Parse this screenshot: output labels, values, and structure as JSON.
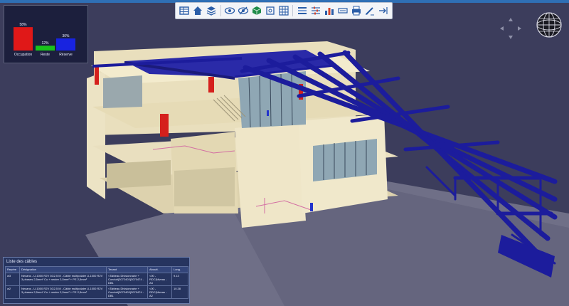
{
  "toolbar": {
    "buttons": [
      {
        "icon": "table-icon"
      },
      {
        "icon": "home-icon"
      },
      {
        "icon": "layers-icon"
      },
      {
        "icon": "eye-icon"
      },
      {
        "icon": "eye-hide-icon"
      },
      {
        "icon": "cube-icon"
      },
      {
        "icon": "frame-icon"
      },
      {
        "icon": "grid-select-icon"
      },
      {
        "icon": "list-view-icon"
      },
      {
        "icon": "sliders-icon"
      },
      {
        "icon": "bar-chart-icon"
      },
      {
        "icon": "label-icon"
      },
      {
        "icon": "print-icon"
      },
      {
        "icon": "pen-icon"
      },
      {
        "icon": "export-icon"
      }
    ]
  },
  "chart_data": {
    "type": "bar",
    "categories": [
      "Occupation",
      "Reste",
      "Réserve"
    ],
    "values": [
      58,
      12,
      30
    ],
    "value_labels": [
      "58%",
      "12%",
      "30%"
    ],
    "colors": [
      "#e01818",
      "#19c31b",
      "#1823e0"
    ],
    "ylim": [
      0,
      60
    ]
  },
  "cables": {
    "title": "Liste des câbles",
    "columns": [
      "Repère",
      "Désignation",
      "Tenant",
      "Aboutt.",
      "Long."
    ],
    "rows": [
      {
        "repere": "w3",
        "designation": "Nexans - U-1000 R2V 3G2.5 M - Câble multipolaire U-1000 R2V 3 phases 2,5mm² Cu + neutre 2,5mm² + PE 2,5mm²",
        "tenant": "<Tableau Divisionnaire + Conduit(3072403(3070474 - DB1",
        "aboutissant": "<00 - RDC|Niveau - A3",
        "longueur": "9.13"
      },
      {
        "repere": "w2",
        "designation": "Nexans - U-1000 R2V 3G2.5 M - Câble multipolaire U-1000 R2V 3 phases 2,5mm² Cu + neutre 2,5mm² + PE 2,5mm²",
        "tenant": "<Tableau Divisionnaire + Conduit(3072403(3070474 - DB1",
        "aboutissant": "<00 - RDC|Niveau - A2",
        "longueur": "10.38"
      }
    ]
  },
  "viewport": {
    "background": "#3c3d5c",
    "structure_color": "#f0e7c6",
    "beam_color": "#1c1c9c",
    "floor_color": "#77778f"
  }
}
